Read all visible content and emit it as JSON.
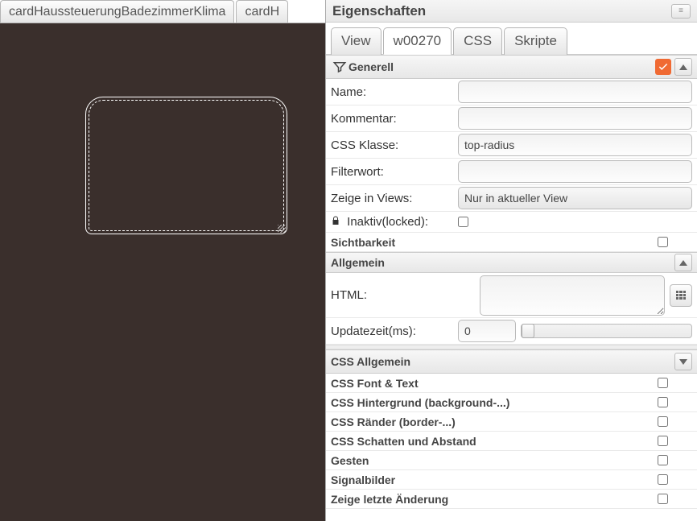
{
  "left_tabs": [
    "cardHaussteuerungBadezimmerKlima",
    "cardH"
  ],
  "header": {
    "title": "Eigenschaften"
  },
  "sub_tabs": {
    "view": "View",
    "wid": "w00270",
    "css": "CSS",
    "scripts": "Skripte"
  },
  "generell": {
    "title": "Generell",
    "name_label": "Name:",
    "name_value": "",
    "kommentar_label": "Kommentar:",
    "kommentar_value": "",
    "cssklasse_label": "CSS Klasse:",
    "cssklasse_value": "top-radius",
    "filter_label": "Filterwort:",
    "filter_value": "",
    "zeige_label": "Zeige in Views:",
    "zeige_option": "Nur in aktueller View",
    "inaktiv_label": "Inaktiv(locked):"
  },
  "sichtbarkeit": {
    "title": "Sichtbarkeit"
  },
  "allgemein": {
    "title": "Allgemein",
    "html_label": "HTML:",
    "html_value": "",
    "update_label": "Updatezeit(ms):",
    "update_value": "0"
  },
  "css_allgemein": {
    "title": "CSS Allgemein"
  },
  "lower_rows": [
    "CSS Font & Text",
    "CSS Hintergrund (background-...)",
    "CSS Ränder (border-...)",
    "CSS Schatten und Abstand",
    "Gesten",
    "Signalbilder",
    "Zeige letzte Änderung"
  ]
}
